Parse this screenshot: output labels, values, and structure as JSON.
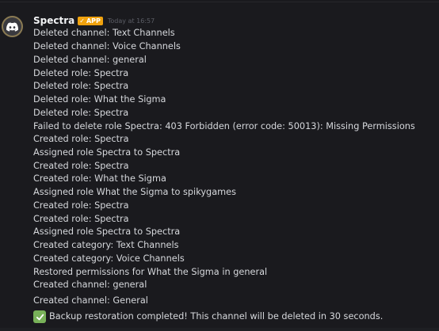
{
  "message": {
    "author": "Spectra",
    "badge": "APP",
    "badge_color": "#f0a20e",
    "timestamp": "Today at 16:57",
    "avatar_icon": "discord-logo-icon",
    "lines": [
      "Deleted channel: Text Channels",
      "Deleted channel: Voice Channels",
      "Deleted channel: general",
      "Deleted role: Spectra",
      "Deleted role: Spectra",
      "Deleted role: What the Sigma",
      "Deleted role: Spectra",
      "Failed to delete role Spectra: 403 Forbidden (error code: 50013): Missing Permissions",
      "Created role: Spectra",
      "Assigned role Spectra to Spectra",
      "Created role: Spectra",
      "Created role: What the Sigma",
      "Assigned role What the Sigma to spikygames",
      "Created role: Spectra",
      "Created role: Spectra",
      "Assigned role Spectra to Spectra",
      "Created category: Text Channels",
      "Created category: Voice Channels",
      "Restored permissions for What the Sigma in general",
      "Created channel: general",
      "Created channel: General"
    ],
    "final_emoji": "check-mark-button-icon",
    "final_text": "Backup restoration completed! This channel will be deleted in 30 seconds."
  }
}
